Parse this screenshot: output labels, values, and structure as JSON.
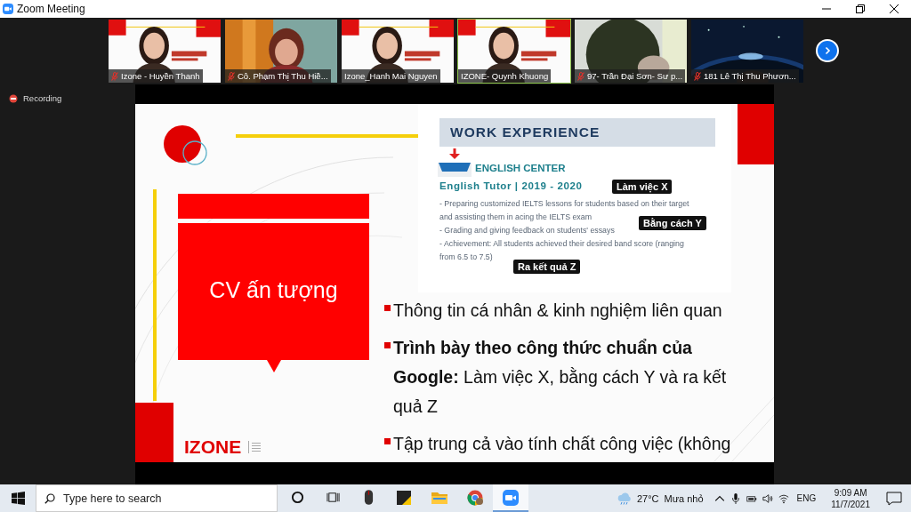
{
  "window": {
    "title": "Zoom Meeting"
  },
  "participants": [
    {
      "name": "Izone - Huyền Thanh",
      "muted": true,
      "speaking": false
    },
    {
      "name": "Cô. Phạm Thị Thu Hiề...",
      "muted": true,
      "speaking": false
    },
    {
      "name": "Izone_Hanh Mai Nguyen",
      "muted": false,
      "speaking": false
    },
    {
      "name": "IZONE- Quynh Khuong",
      "muted": false,
      "speaking": true
    },
    {
      "name": "97- Trần Đại Sơn- Sư p...",
      "muted": true,
      "speaking": false
    },
    {
      "name": "181 Lê Thị Thu Phươn...",
      "muted": true,
      "speaking": false
    }
  ],
  "recording": {
    "label": "Recording"
  },
  "slide": {
    "title": "CV ấn tượng",
    "logo": "IZONE",
    "cv_image": {
      "heading": "WORK EXPERIENCE",
      "company": "ENGLISH CENTER",
      "role": "English Tutor | 2019 - 2020",
      "lines": [
        "- Preparing customized IELTS lessons for students based on their target",
        "and assisting them in acing the IELTS exam",
        "- Grading and giving feedback on students' essays",
        "- Achievement: All students achieved their desired band score (ranging",
        "from 6.5 to 7.5)"
      ],
      "callouts": [
        "Làm việc X",
        "Bằng cách Y",
        "Ra kết quả Z"
      ]
    },
    "bullets": [
      "Thông tin cá nhân & kinh nghiệm liên quan",
      "**Trình bày theo công thức chuẩn của Google:** Làm việc X, bằng cách Y và ra kết quả Z",
      "Tập trung cả vào tính chất công việc (không"
    ]
  },
  "taskbar": {
    "search_placeholder": "Type here to search",
    "apps": [
      {
        "kind": "cortana",
        "active": false
      },
      {
        "kind": "taskview",
        "active": false
      },
      {
        "kind": "mouse",
        "active": false
      },
      {
        "kind": "notes",
        "active": false
      },
      {
        "kind": "folder",
        "active": false
      },
      {
        "kind": "browser",
        "active": false
      },
      {
        "kind": "zoom",
        "active": true
      }
    ],
    "temperature": "27°C",
    "weather": "Mưa nhỏ",
    "language": "ENG",
    "time": "9:09 AM",
    "date": "11/7/2021"
  }
}
